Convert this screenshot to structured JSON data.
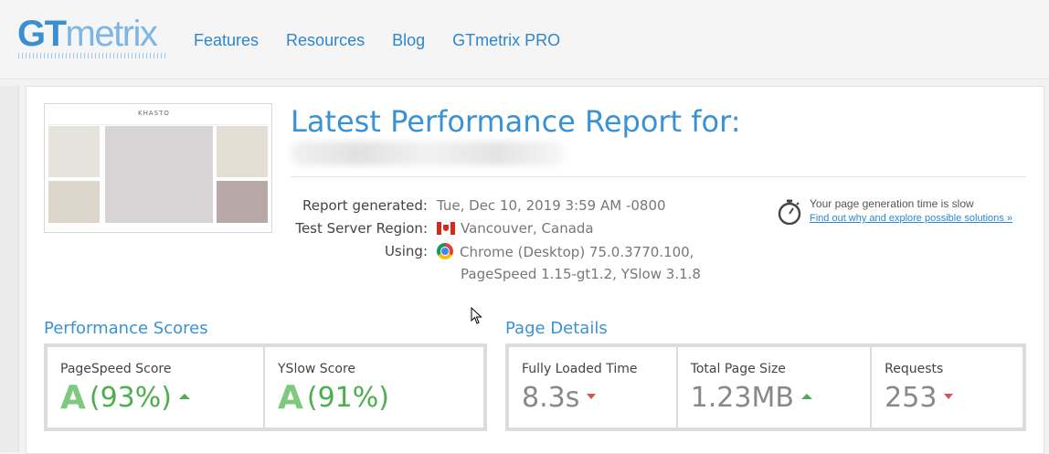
{
  "logo": {
    "strong": "GT",
    "light": "metrix"
  },
  "nav": [
    {
      "label": "Features"
    },
    {
      "label": "Resources"
    },
    {
      "label": "Blog"
    },
    {
      "label": "GTmetrix PRO"
    }
  ],
  "thumbnail": {
    "brand": "KHASTO"
  },
  "report": {
    "title": "Latest Performance Report for:",
    "rows": [
      {
        "label": "Report generated:",
        "value": "Tue, Dec 10, 2019 3:59 AM -0800"
      },
      {
        "label": "Test Server Region:",
        "value": "Vancouver, Canada",
        "icon": "canada-flag-icon"
      },
      {
        "label": "Using:",
        "value": "Chrome (Desktop) 75.0.3770.100,",
        "value2": "PageSpeed 1.15-gt1.2, YSlow 3.1.8",
        "icon": "chrome-icon"
      }
    ]
  },
  "notice": {
    "icon": "stopwatch-icon",
    "text": "Your page generation time is slow",
    "link": "Find out why and explore possible solutions »"
  },
  "performance": {
    "title": "Performance Scores",
    "scores": [
      {
        "label": "PageSpeed Score",
        "grade": "A",
        "value": "(93%)",
        "trend": "up"
      },
      {
        "label": "YSlow Score",
        "grade": "A",
        "value": "(91%)"
      }
    ]
  },
  "details": {
    "title": "Page Details",
    "items": [
      {
        "label": "Fully Loaded Time",
        "value": "8.3s",
        "trend": "down"
      },
      {
        "label": "Total Page Size",
        "value": "1.23MB",
        "trend": "up"
      },
      {
        "label": "Requests",
        "value": "253",
        "trend": "down"
      }
    ]
  },
  "colors": {
    "accent": "#3a92d4",
    "good": "#4cae4c",
    "bad": "#d9534f"
  }
}
